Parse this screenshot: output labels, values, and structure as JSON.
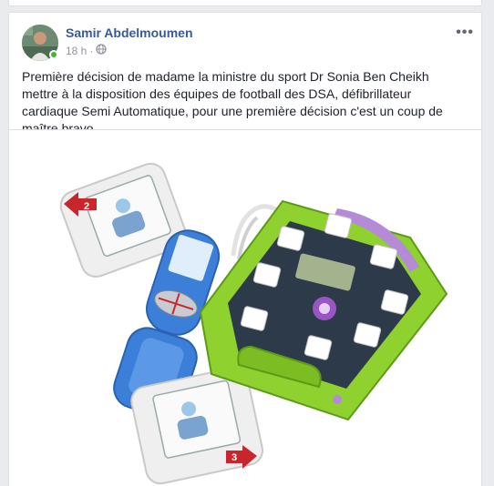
{
  "post": {
    "author_name": "Samir Abdelmoumen",
    "timestamp": "18 h",
    "separator": "·",
    "audience_icon": "globe-icon",
    "more_icon": "more-options-icon",
    "more_label": "•••",
    "text": "Première décision de madame la ministre du sport Dr Sonia Ben Cheikh mettre à la disposition des équipes de football des DSA, défibrillateur cardiaque Semi Automatique, pour une première décision c'est un coup de maître bravo.",
    "image": {
      "pad_label_left": "2",
      "pad_label_right": "3",
      "device_icon": "defibrillator-image"
    }
  },
  "colors": {
    "link": "#385898",
    "device_green": "#8fd12e",
    "device_dark": "#2d3a4a",
    "pad_blue": "#3a7cd6",
    "online": "#42b72a"
  }
}
